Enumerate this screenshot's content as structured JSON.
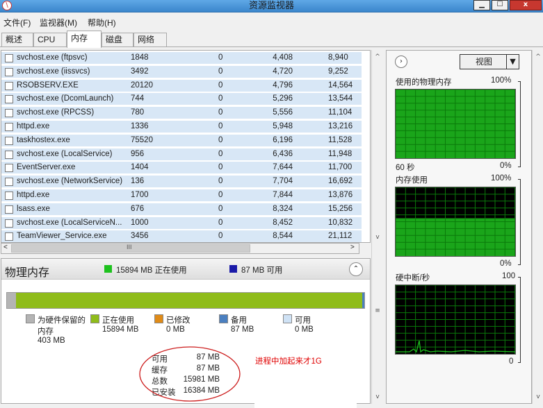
{
  "window": {
    "title": "资源监视器",
    "min_label": "▁",
    "max_label": "☐",
    "close_label": "x"
  },
  "menu": [
    "文件(F)",
    "监视器(M)",
    "帮助(H)"
  ],
  "tabs": [
    "概述",
    "CPU",
    "内存",
    "磁盘",
    "网络"
  ],
  "active_tab": "内存",
  "processes": [
    {
      "name": "svchost.exe (ftpsvc)",
      "pid": "1848",
      "hard_faults": "0",
      "commit": "4,408",
      "working_set": "8,940"
    },
    {
      "name": "svchost.exe (iissvcs)",
      "pid": "3492",
      "hard_faults": "0",
      "commit": "4,720",
      "working_set": "9,252"
    },
    {
      "name": "RSOBSERV.EXE",
      "pid": "20120",
      "hard_faults": "0",
      "commit": "4,796",
      "working_set": "14,564"
    },
    {
      "name": "svchost.exe (DcomLaunch)",
      "pid": "744",
      "hard_faults": "0",
      "commit": "5,296",
      "working_set": "13,544"
    },
    {
      "name": "svchost.exe (RPCSS)",
      "pid": "780",
      "hard_faults": "0",
      "commit": "5,556",
      "working_set": "11,104"
    },
    {
      "name": "httpd.exe",
      "pid": "1336",
      "hard_faults": "0",
      "commit": "5,948",
      "working_set": "13,216"
    },
    {
      "name": "taskhostex.exe",
      "pid": "75520",
      "hard_faults": "0",
      "commit": "6,196",
      "working_set": "11,528"
    },
    {
      "name": "svchost.exe (LocalService)",
      "pid": "956",
      "hard_faults": "0",
      "commit": "6,436",
      "working_set": "11,948"
    },
    {
      "name": "EventServer.exe",
      "pid": "1404",
      "hard_faults": "0",
      "commit": "7,644",
      "working_set": "11,700"
    },
    {
      "name": "svchost.exe (NetworkService)",
      "pid": "136",
      "hard_faults": "0",
      "commit": "7,704",
      "working_set": "16,692"
    },
    {
      "name": "httpd.exe",
      "pid": "1700",
      "hard_faults": "0",
      "commit": "7,844",
      "working_set": "13,876"
    },
    {
      "name": "lsass.exe",
      "pid": "676",
      "hard_faults": "0",
      "commit": "8,324",
      "working_set": "15,256"
    },
    {
      "name": "svchost.exe (LocalServiceN...",
      "pid": "1000",
      "hard_faults": "0",
      "commit": "8,452",
      "working_set": "10,832"
    },
    {
      "name": "TeamViewer_Service.exe",
      "pid": "3456",
      "hard_faults": "0",
      "commit": "8,544",
      "working_set": "21,112"
    }
  ],
  "hscroll": {
    "left": "<",
    "thumb": "III",
    "right": ">"
  },
  "vscroll": {
    "up": "^",
    "down": "v",
    "grip": "≡"
  },
  "memory": {
    "title": "物理内存",
    "in_use_label": "15894 MB 正在使用",
    "available_label": "87 MB 可用",
    "in_use_color": "#1ec21e",
    "available_color": "#1a1aa8",
    "bar_fractions": {
      "reserved": 0.025,
      "in_use": 0.97,
      "modified": 0.0,
      "standby": 0.005
    },
    "categories": [
      {
        "label": "为硬件保留的",
        "label2": "内存",
        "value": "403 MB",
        "color": "#b4b4b4"
      },
      {
        "label": "正在使用",
        "value": "15894 MB",
        "color": "#8fbc1a"
      },
      {
        "label": "已修改",
        "value": "0 MB",
        "color": "#e08b17"
      },
      {
        "label": "备用",
        "value": "87 MB",
        "color": "#4a7fc0"
      },
      {
        "label": "可用",
        "value": "0 MB",
        "color": "#cfe2f5"
      }
    ],
    "stats": [
      {
        "label": "可用",
        "value": "87 MB"
      },
      {
        "label": "缓存",
        "value": "87 MB"
      },
      {
        "label": "总数",
        "value": "15981 MB"
      },
      {
        "label": "已安装",
        "value": "16384 MB"
      }
    ],
    "annotation": "进程中加起来才1G",
    "annotation_color": "#e00000"
  },
  "graphs": {
    "view_label": "视图",
    "physical": {
      "title": "使用的物理内存",
      "max": "100%",
      "min": "0%",
      "time": "60 秒",
      "level": 0.998
    },
    "commit": {
      "title": "内存使用",
      "max": "100%",
      "min": "0%",
      "level": 0.55
    },
    "faults": {
      "title": "硬中断/秒",
      "max": "100",
      "min": "0"
    },
    "line_color": "#1ec21e",
    "grid_color": "#0a7a0a"
  }
}
